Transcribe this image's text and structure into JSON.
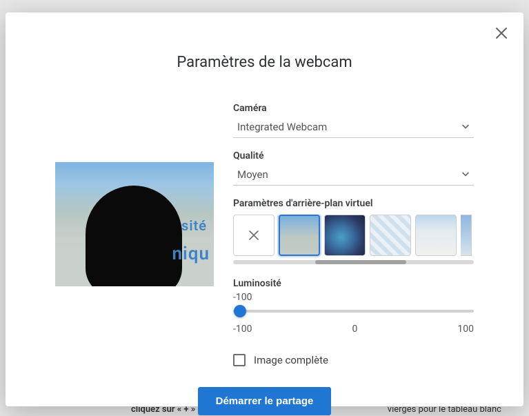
{
  "modal": {
    "title": "Paramètres de la webcam",
    "close_icon": "close-icon"
  },
  "preview": {
    "overlay_text_1": "sité",
    "overlay_text_2": "niqu"
  },
  "camera": {
    "label": "Caméra",
    "value": "Integrated Webcam"
  },
  "quality": {
    "label": "Qualité",
    "value": "Moyen"
  },
  "virtual_bg": {
    "label": "Paramètres d'arrière-plan virtuel",
    "options": [
      {
        "name": "none",
        "icon": "x"
      },
      {
        "name": "building-preview",
        "selected": true
      },
      {
        "name": "nebula-blur"
      },
      {
        "name": "geo-pattern"
      },
      {
        "name": "campus"
      },
      {
        "name": "sky-partial"
      }
    ]
  },
  "brightness": {
    "label": "Luminosité",
    "value": "-100",
    "min": "-100",
    "mid": "0",
    "max": "100"
  },
  "full_image": {
    "label": "Image complète",
    "checked": false
  },
  "actions": {
    "start": "Démarrer le partage"
  },
  "background_hints": {
    "click_plus": "cliquez sur « + »",
    "whiteboard": "vierges pour le tableau blanc"
  }
}
